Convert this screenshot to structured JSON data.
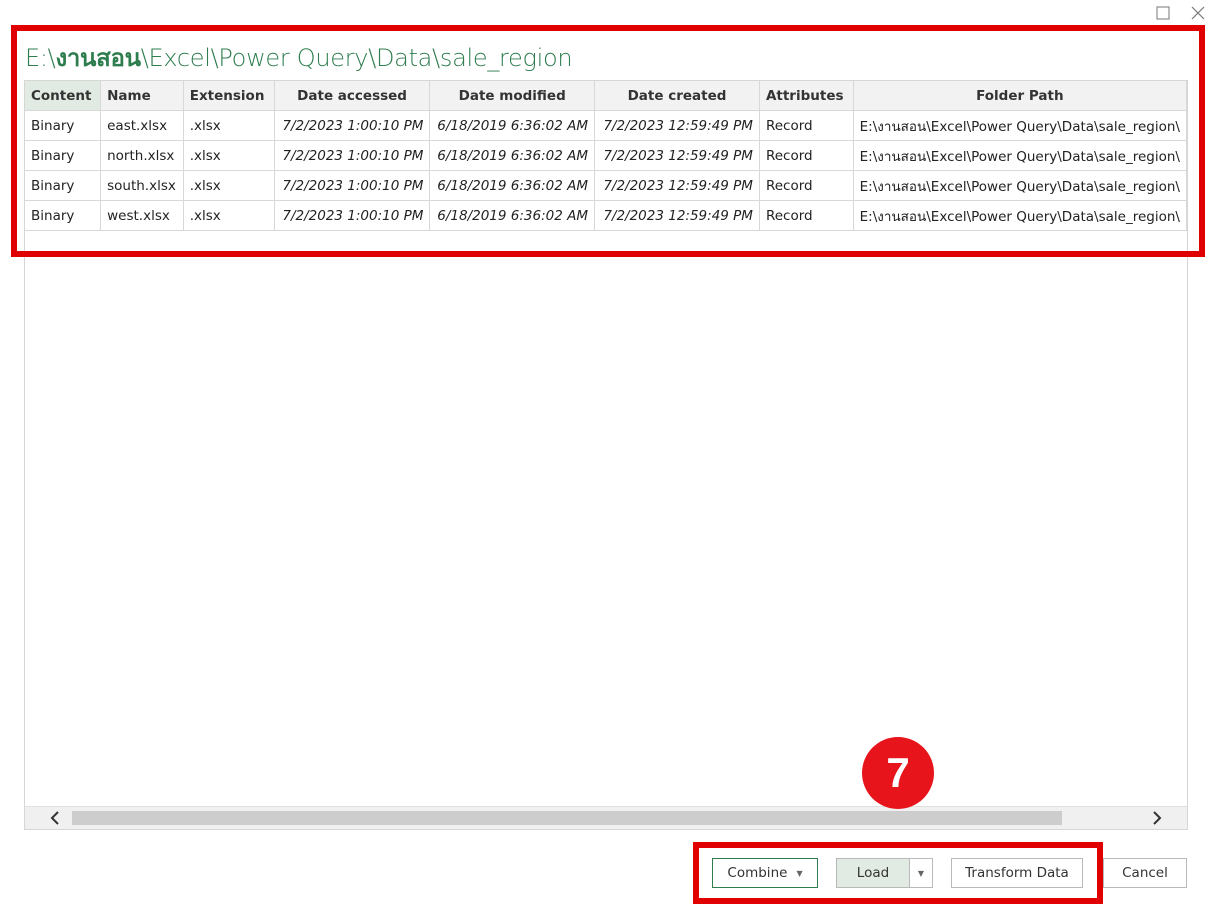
{
  "window": {
    "maximize_icon": "maximize-icon",
    "close_icon": "close-icon"
  },
  "title": {
    "prefix": "E:\\",
    "bold": "งานสอน",
    "suffix": "\\Excel\\Power Query\\Data\\sale_region"
  },
  "table": {
    "columns": [
      "Content",
      "Name",
      "Extension",
      "Date accessed",
      "Date modified",
      "Date created",
      "Attributes",
      "Folder Path"
    ],
    "rows": [
      [
        "Binary",
        "east.xlsx",
        ".xlsx",
        "7/2/2023 1:00:10 PM",
        "6/18/2019 6:36:02 AM",
        "7/2/2023 12:59:49 PM",
        "Record",
        "E:\\งานสอน\\Excel\\Power Query\\Data\\sale_region\\"
      ],
      [
        "Binary",
        "north.xlsx",
        ".xlsx",
        "7/2/2023 1:00:10 PM",
        "6/18/2019 6:36:02 AM",
        "7/2/2023 12:59:49 PM",
        "Record",
        "E:\\งานสอน\\Excel\\Power Query\\Data\\sale_region\\"
      ],
      [
        "Binary",
        "south.xlsx",
        ".xlsx",
        "7/2/2023 1:00:10 PM",
        "6/18/2019 6:36:02 AM",
        "7/2/2023 12:59:49 PM",
        "Record",
        "E:\\งานสอน\\Excel\\Power Query\\Data\\sale_region\\"
      ],
      [
        "Binary",
        "west.xlsx",
        ".xlsx",
        "7/2/2023 1:00:10 PM",
        "6/18/2019 6:36:02 AM",
        "7/2/2023 12:59:49 PM",
        "Record",
        "E:\\งานสอน\\Excel\\Power Query\\Data\\sale_region\\"
      ]
    ]
  },
  "scrollbar": {
    "left_arrow": "<",
    "right_arrow": ">"
  },
  "annotation": {
    "step": "7",
    "highlight_color": "#e10000"
  },
  "buttons": {
    "combine": "Combine",
    "load": "Load",
    "transform": "Transform Data",
    "cancel": "Cancel",
    "dropdown_glyph": "▼"
  },
  "colors": {
    "title_green": "#2e7d4f",
    "accent_green_bg": "#e1ebe3",
    "badge_red": "#e8141c"
  }
}
